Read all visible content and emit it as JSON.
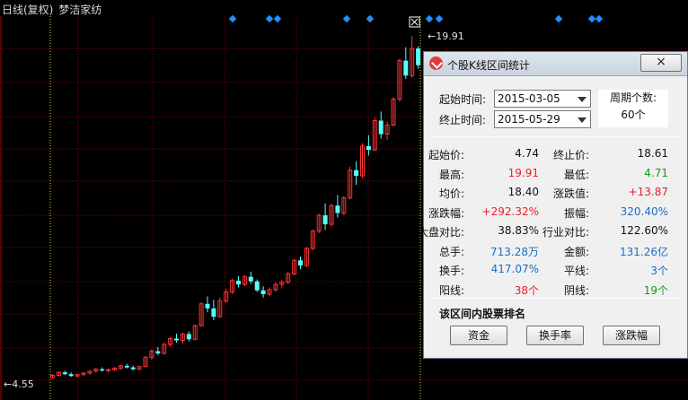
{
  "chart_header": {
    "period": "日线(复权)",
    "stock_name": "梦洁家纺"
  },
  "chart": {
    "high_marker": "19.91",
    "low_marker": "4.55",
    "colors": {
      "up": "#ff3232",
      "down": "#54ffff",
      "bg": "#000000",
      "grid": "#8b0000",
      "diamond": "#1e90ff"
    }
  },
  "chart_data": {
    "type": "candlestick",
    "title": "",
    "ohlc": [
      [
        4.74,
        4.9,
        4.71,
        4.85
      ],
      [
        4.85,
        5.02,
        4.8,
        4.98
      ],
      [
        4.98,
        5.05,
        4.86,
        4.9
      ],
      [
        4.9,
        4.98,
        4.78,
        4.82
      ],
      [
        4.82,
        4.92,
        4.76,
        4.88
      ],
      [
        4.88,
        4.99,
        4.82,
        4.95
      ],
      [
        4.95,
        5.08,
        4.88,
        5.03
      ],
      [
        5.03,
        5.18,
        4.97,
        5.12
      ],
      [
        5.12,
        5.2,
        5.02,
        5.06
      ],
      [
        5.06,
        5.15,
        4.96,
        5.1
      ],
      [
        5.1,
        5.22,
        5.04,
        5.16
      ],
      [
        5.16,
        5.32,
        5.1,
        5.27
      ],
      [
        5.27,
        5.35,
        5.15,
        5.2
      ],
      [
        5.2,
        5.28,
        5.06,
        5.12
      ],
      [
        5.12,
        5.28,
        5.08,
        5.24
      ],
      [
        5.24,
        5.7,
        5.2,
        5.65
      ],
      [
        5.65,
        6.0,
        5.55,
        5.92
      ],
      [
        5.92,
        6.1,
        5.75,
        5.82
      ],
      [
        5.82,
        6.3,
        5.78,
        6.22
      ],
      [
        6.22,
        6.55,
        6.1,
        6.48
      ],
      [
        6.48,
        6.7,
        6.3,
        6.4
      ],
      [
        6.4,
        6.75,
        6.25,
        6.68
      ],
      [
        6.68,
        6.8,
        6.35,
        6.45
      ],
      [
        6.45,
        7.1,
        6.4,
        7.05
      ],
      [
        7.05,
        8.1,
        7.0,
        8.02
      ],
      [
        8.02,
        8.35,
        7.65,
        7.82
      ],
      [
        7.82,
        8.2,
        7.3,
        7.45
      ],
      [
        7.45,
        8.3,
        7.4,
        8.15
      ],
      [
        8.15,
        8.7,
        8.05,
        8.55
      ],
      [
        8.55,
        9.15,
        8.45,
        9.05
      ],
      [
        9.05,
        9.25,
        8.75,
        8.88
      ],
      [
        8.88,
        9.3,
        8.8,
        9.22
      ],
      [
        9.22,
        9.45,
        8.9,
        9.02
      ],
      [
        9.02,
        9.1,
        8.55,
        8.62
      ],
      [
        8.62,
        8.8,
        8.3,
        8.45
      ],
      [
        8.45,
        8.75,
        8.35,
        8.65
      ],
      [
        8.65,
        8.98,
        8.55,
        8.88
      ],
      [
        8.88,
        9.08,
        8.7,
        8.98
      ],
      [
        8.98,
        9.45,
        8.9,
        9.35
      ],
      [
        9.35,
        10.02,
        9.3,
        9.95
      ],
      [
        9.95,
        10.12,
        9.55,
        9.72
      ],
      [
        9.72,
        10.55,
        9.65,
        10.48
      ],
      [
        10.48,
        11.32,
        10.4,
        11.25
      ],
      [
        11.25,
        12.02,
        11.15,
        11.95
      ],
      [
        11.95,
        12.48,
        11.3,
        11.55
      ],
      [
        11.55,
        12.45,
        11.45,
        12.38
      ],
      [
        12.38,
        12.85,
        11.85,
        12.05
      ],
      [
        12.05,
        12.8,
        11.95,
        12.72
      ],
      [
        12.72,
        14.1,
        12.65,
        13.95
      ],
      [
        13.95,
        14.35,
        13.3,
        13.7
      ],
      [
        13.7,
        15.15,
        13.6,
        15.02
      ],
      [
        15.02,
        15.5,
        14.6,
        14.85
      ],
      [
        14.85,
        16.3,
        14.8,
        16.15
      ],
      [
        16.15,
        16.55,
        15.35,
        15.55
      ],
      [
        15.55,
        16.1,
        15.3,
        15.95
      ],
      [
        15.95,
        17.2,
        15.9,
        17.1
      ],
      [
        17.1,
        18.9,
        17.0,
        18.81
      ],
      [
        18.81,
        19.4,
        18.0,
        18.15
      ],
      [
        18.15,
        19.91,
        18.05,
        19.35
      ],
      [
        19.35,
        19.45,
        18.45,
        18.61
      ]
    ]
  },
  "dialog": {
    "title": "个股K线区间统计",
    "close_label": "×",
    "start_label": "起始时间:",
    "start_value": "2015-03-05",
    "end_label": "终止时间:",
    "end_value": "2015-05-29",
    "cycle_label": "周期个数:",
    "cycle_value": "60个",
    "stats": [
      [
        {
          "k": "起始价:",
          "v": "4.74",
          "c": "#111111"
        },
        {
          "k": "终止价:",
          "v": "18.61",
          "c": "#111111"
        }
      ],
      [
        {
          "k": "最高:",
          "v": "19.91",
          "c": "#e8202a"
        },
        {
          "k": "最低:",
          "v": "4.71",
          "c": "#1a9a1a"
        }
      ],
      [
        {
          "k": "均价:",
          "v": "18.40",
          "c": "#111111"
        },
        {
          "k": "涨跌值:",
          "v": "+13.87",
          "c": "#e8202a"
        }
      ],
      [
        {
          "k": "涨跌幅:",
          "v": "+292.32%",
          "c": "#e8202a"
        },
        {
          "k": "振幅:",
          "v": "320.40%",
          "c": "#1a6fc0"
        }
      ],
      [
        {
          "k": "大盘对比:",
          "v": "38.83%",
          "c": "#111111"
        },
        {
          "k": "行业对比:",
          "v": "122.60%",
          "c": "#111111"
        }
      ],
      [
        {
          "k": "总手:",
          "v": "713.28万",
          "c": "#1a6fc0"
        },
        {
          "k": "金额:",
          "v": "131.26亿",
          "c": "#1a6fc0"
        }
      ],
      [
        {
          "k": "换手:",
          "v": "417.07%",
          "c": "#1a6fc0"
        },
        {
          "k": "平线:",
          "v": "3个",
          "c": "#1a6fc0"
        }
      ],
      [
        {
          "k": "阳线:",
          "v": "38个",
          "c": "#e8202a"
        },
        {
          "k": "阴线:",
          "v": "19个",
          "c": "#1a9a1a"
        }
      ]
    ],
    "rank_label": "该区间内股票排名",
    "buttons": [
      "资金",
      "换手率",
      "涨跌幅"
    ]
  }
}
